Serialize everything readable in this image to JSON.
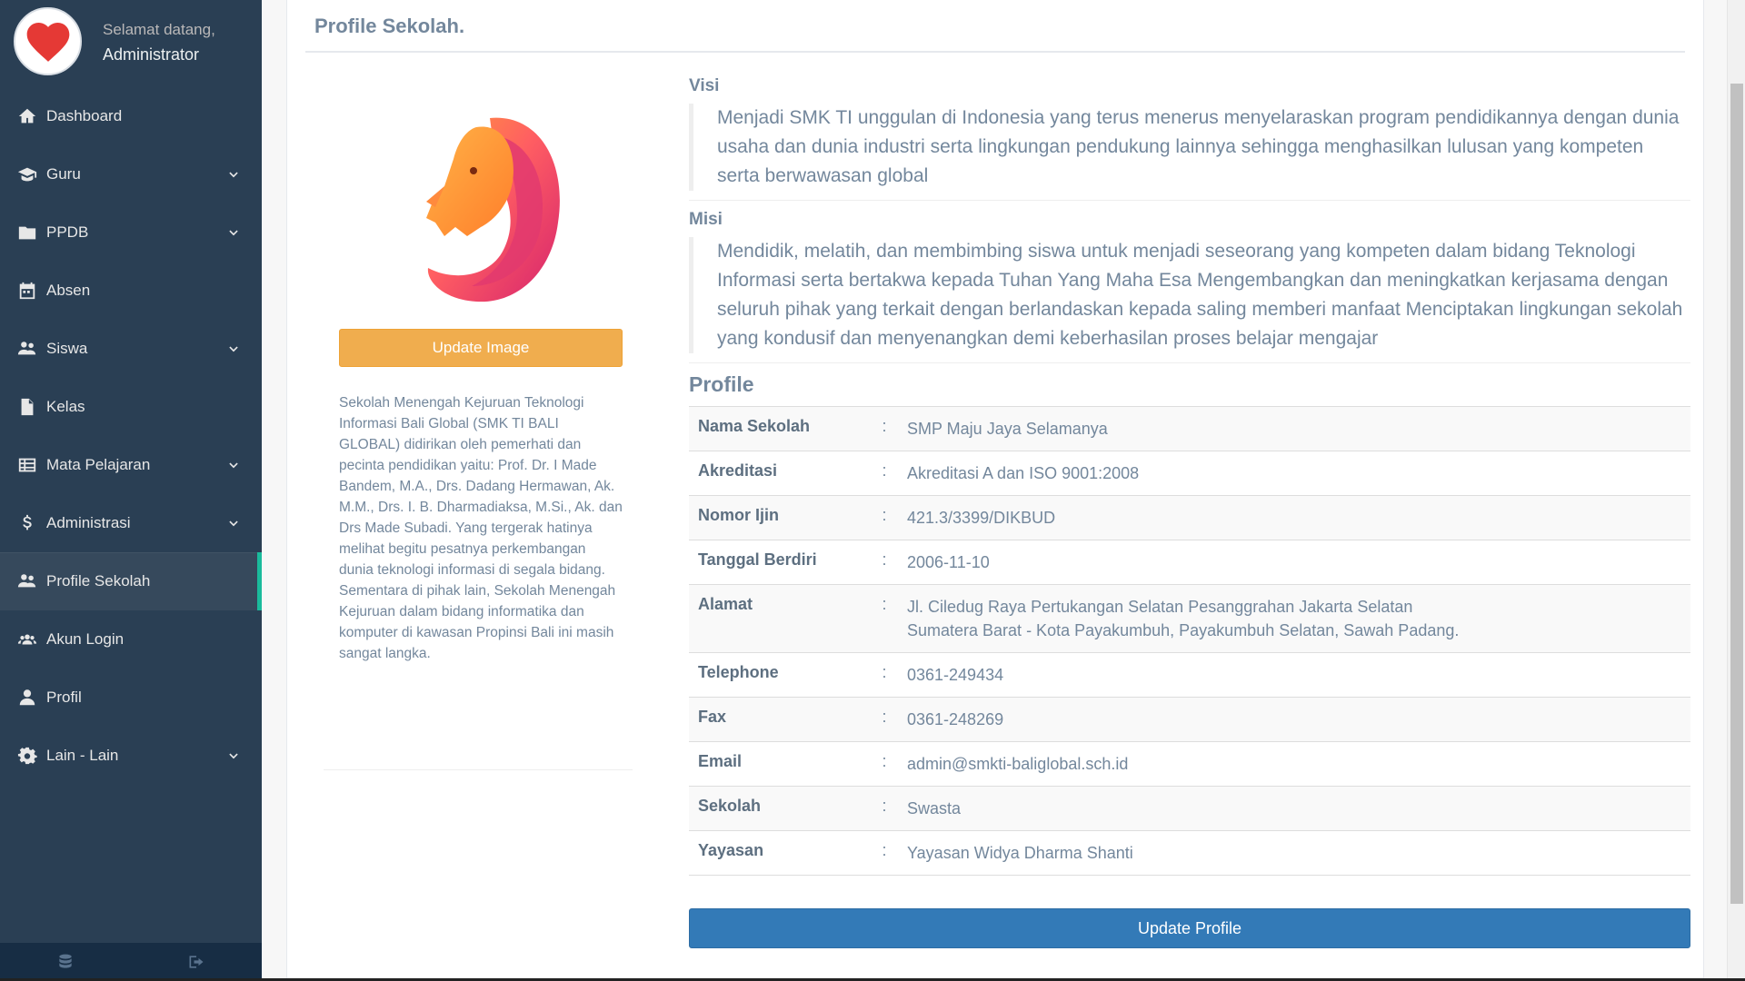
{
  "sidebar": {
    "welcome": "Selamat datang,",
    "username": "Administrator",
    "items": [
      {
        "label": "Dashboard",
        "icon": "home-icon",
        "has_children": false
      },
      {
        "label": "Guru",
        "icon": "graduation-cap-icon",
        "has_children": true
      },
      {
        "label": "PPDB",
        "icon": "folder-icon",
        "has_children": true
      },
      {
        "label": "Absen",
        "icon": "calendar-icon",
        "has_children": false
      },
      {
        "label": "Siswa",
        "icon": "users-icon",
        "has_children": true
      },
      {
        "label": "Kelas",
        "icon": "file-text-icon",
        "has_children": false
      },
      {
        "label": "Mata Pelajaran",
        "icon": "table-icon",
        "has_children": true
      },
      {
        "label": "Administrasi",
        "icon": "dollar-icon",
        "has_children": true
      },
      {
        "label": "Profile Sekolah",
        "icon": "users-icon",
        "has_children": false,
        "active": true
      },
      {
        "label": "Akun Login",
        "icon": "users-small-icon",
        "has_children": false
      },
      {
        "label": "Profil",
        "icon": "user-icon",
        "has_children": false
      },
      {
        "label": "Lain - Lain",
        "icon": "gear-icon",
        "has_children": true
      }
    ],
    "footer_icons": [
      "database-icon",
      "sign-out-icon"
    ]
  },
  "panel": {
    "title": "Profile Sekolah."
  },
  "left": {
    "update_image_label": "Update Image",
    "description": "Sekolah Menengah Kejuruan Teknologi Informasi Bali Global (SMK TI BALI GLOBAL) didirikan oleh pemerhati dan pecinta pendidikan yaitu: Prof. Dr. I Made Bandem, M.A., Drs. Dadang Hermawan, Ak. M.M., Drs. I. B. Dharmadiaksa, M.Si., Ak. dan Drs Made Subadi. Yang tergerak hatinya melihat begitu pesatnya perkembangan dunia teknologi informasi di segala bidang. Sementara di pihak lain, Sekolah Menengah Kejuruan dalam bidang informatika dan komputer di kawasan Propinsi Bali ini masih sangat langka."
  },
  "visi": {
    "heading": "Visi",
    "text": "Menjadi SMK TI unggulan di Indonesia yang terus menerus menyelaraskan program pendidikannya dengan dunia usaha dan dunia industri serta lingkungan pendukung lainnya sehingga menghasilkan lulusan yang kompeten serta berwawasan global"
  },
  "misi": {
    "heading": "Misi",
    "text": "Mendidik, melatih, dan membimbing siswa untuk menjadi seseorang yang kompeten dalam bidang Teknologi Informasi serta bertakwa kepada Tuhan Yang Maha Esa Mengembangkan dan meningkatkan kerjasama dengan seluruh pihak yang terkait dengan berlandaskan kepada saling memberi manfaat Menciptakan lingkungan sekolah yang kondusif dan menyenangkan demi keberhasilan proses belajar mengajar"
  },
  "profile": {
    "heading": "Profile",
    "separator": ":",
    "rows": [
      {
        "label": "Nama Sekolah",
        "value": "SMP Maju Jaya Selamanya"
      },
      {
        "label": "Akreditasi",
        "value": "Akreditasi A dan ISO 9001:2008"
      },
      {
        "label": "Nomor Ijin",
        "value": "421.3/3399/DIKBUD"
      },
      {
        "label": "Tanggal Berdiri",
        "value": "2006-11-10"
      },
      {
        "label": "Alamat",
        "value": "Jl. Ciledug Raya Pertukangan Selatan Pesanggrahan Jakarta Selatan",
        "value2": "Sumatera Barat - Kota Payakumbuh, Payakumbuh Selatan, Sawah Padang."
      },
      {
        "label": "Telephone",
        "value": "0361-249434"
      },
      {
        "label": "Fax",
        "value": "0361-248269"
      },
      {
        "label": "Email",
        "value": "admin@smkti-baliglobal.sch.id"
      },
      {
        "label": "Sekolah",
        "value": "Swasta"
      },
      {
        "label": "Yayasan",
        "value": "Yayasan Widya Dharma Shanti"
      }
    ],
    "update_profile_label": "Update Profile"
  },
  "colors": {
    "sidebar_bg": "#2a3f54",
    "active_accent": "#1abb9c",
    "warning_button": "#f0ad4e",
    "primary_button": "#337ab7",
    "avatar_heart": "#e53935"
  }
}
